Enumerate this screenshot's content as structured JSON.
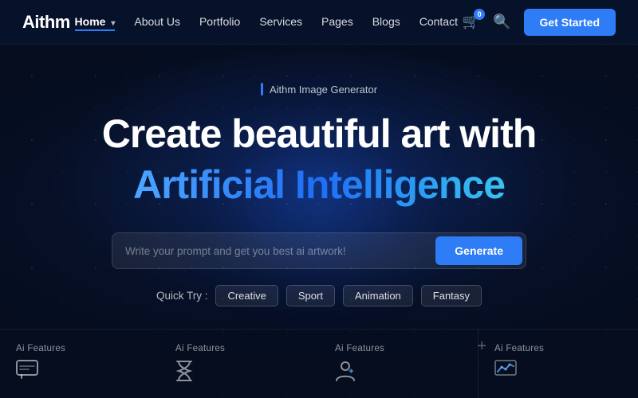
{
  "brand": {
    "name": "Aithm"
  },
  "nav": {
    "links": [
      {
        "label": "Home",
        "active": true,
        "has_arrow": true
      },
      {
        "label": "About Us",
        "active": false,
        "has_arrow": false
      },
      {
        "label": "Portfolio",
        "active": false,
        "has_arrow": false
      },
      {
        "label": "Services",
        "active": false,
        "has_arrow": false
      },
      {
        "label": "Pages",
        "active": false,
        "has_arrow": false
      },
      {
        "label": "Blogs",
        "active": false,
        "has_arrow": false
      },
      {
        "label": "Contact",
        "active": false,
        "has_arrow": false
      }
    ],
    "cart_count": "0",
    "get_started_label": "Get Started"
  },
  "hero": {
    "badge_text": "Aithm Image Generator",
    "title_line1": "Create beautiful art with",
    "title_line2": "Artificial Intelligence",
    "search_placeholder": "Write your prompt and get you best ai artwork!",
    "generate_label": "Generate",
    "quick_try_label": "Quick Try :",
    "quick_tags": [
      "Creative",
      "Sport",
      "Animation",
      "Fantasy"
    ]
  },
  "features": [
    {
      "label": "Ai Features",
      "icon": "chat-icon"
    },
    {
      "label": "Ai Features",
      "icon": "hourglass-icon"
    },
    {
      "label": "Ai Features",
      "icon": "person-icon"
    },
    {
      "label": "Ai Features",
      "icon": "chart-icon"
    }
  ],
  "colors": {
    "accent": "#2e7cf6",
    "bg_dark": "#050d1f",
    "nav_bg": "#06112a"
  }
}
